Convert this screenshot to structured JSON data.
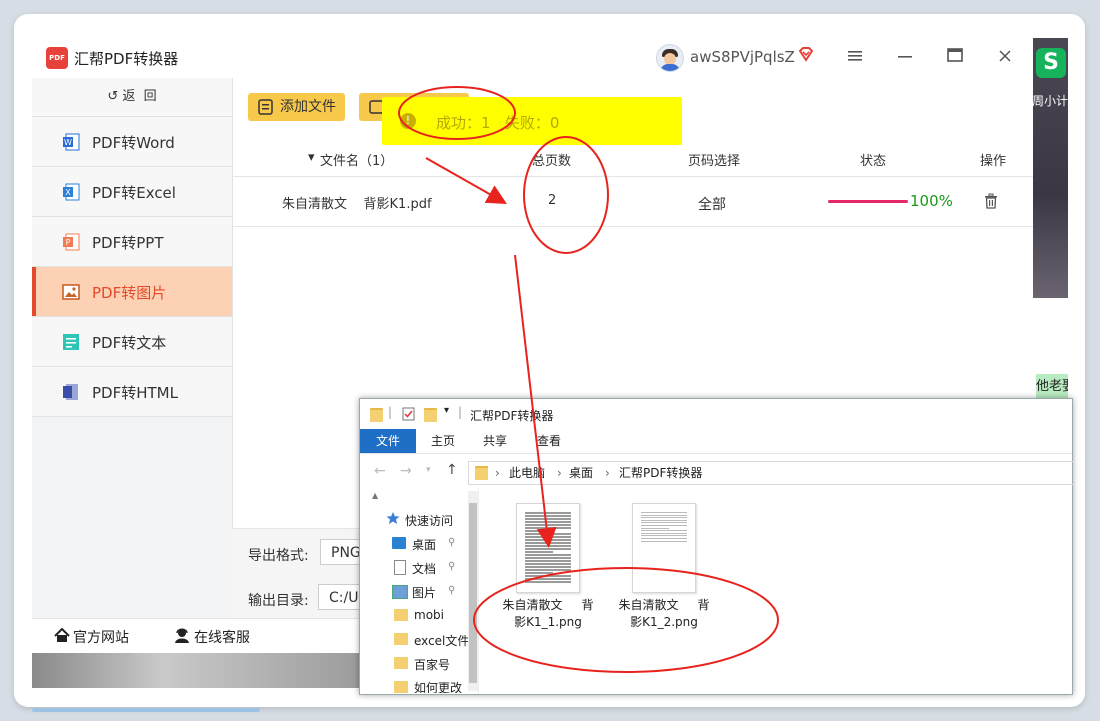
{
  "app": {
    "title": "汇帮PDF转换器",
    "logo_text": "PDF",
    "username": "awS8PVjPqlsZ",
    "vip_icon": "vip-diamond-icon",
    "window_controls": [
      "menu-icon",
      "minimize-icon",
      "maximize-icon",
      "close-icon"
    ]
  },
  "sidebar": {
    "back_label": "返  回",
    "items": [
      {
        "label": "PDF转Word",
        "icon": "word-icon",
        "color": "#2b6cd6",
        "active": false
      },
      {
        "label": "PDF转Excel",
        "icon": "excel-icon",
        "color": "#2e7fd8",
        "active": false
      },
      {
        "label": "PDF转PPT",
        "icon": "ppt-icon",
        "color": "#f07c54",
        "active": false
      },
      {
        "label": "PDF转图片",
        "icon": "image-icon",
        "color": "#c9612a",
        "active": true
      },
      {
        "label": "PDF转文本",
        "icon": "text-icon",
        "color": "#2ec4b6",
        "active": false
      },
      {
        "label": "PDF转HTML",
        "icon": "html-icon",
        "color": "#3b4fa8",
        "active": false
      }
    ]
  },
  "toolbar": {
    "add_file": "添加文件"
  },
  "toast": {
    "text": "成功：1   失败：0"
  },
  "table": {
    "headers": {
      "filename": "文件名（1）",
      "pages": "总页数",
      "page_select": "页码选择",
      "status": "状态",
      "action": "操作"
    },
    "rows": [
      {
        "filename": "朱自清散文    背影K1.pdf",
        "pages": "2",
        "page_select": "全部",
        "progress": 100,
        "progress_text": "100%"
      }
    ]
  },
  "settings": {
    "format_label": "导出格式:",
    "format_value": "PNG",
    "dir_label": "输出目录:",
    "dir_value": "C:/U"
  },
  "footer": {
    "website": "官方网站",
    "service": "在线客服"
  },
  "explorer": {
    "title": "汇帮PDF转换器",
    "tabs": [
      "文件",
      "主页",
      "共享",
      "查看"
    ],
    "breadcrumb": [
      "此电脑",
      "桌面",
      "汇帮PDF转换器"
    ],
    "nav": [
      {
        "label": "快速访问",
        "icon": "star-icon"
      },
      {
        "label": "桌面",
        "icon": "desktop-icon"
      },
      {
        "label": "文档",
        "icon": "document-icon"
      },
      {
        "label": "图片",
        "icon": "picture-icon"
      },
      {
        "label": "mobi",
        "icon": "folder-icon"
      },
      {
        "label": "excel文件",
        "icon": "folder-icon"
      },
      {
        "label": "百家号",
        "icon": "folder-icon"
      },
      {
        "label": "如何更改",
        "icon": "folder-icon"
      }
    ],
    "files": [
      {
        "name_line1": "朱自清散文     背",
        "name_line2": "影K1_1.png"
      },
      {
        "name_line1": "朱自清散文     背",
        "name_line2": "影K1_2.png"
      }
    ]
  },
  "background": {
    "app_letter": "S",
    "text1": "周小计",
    "text2": "他老娶"
  }
}
